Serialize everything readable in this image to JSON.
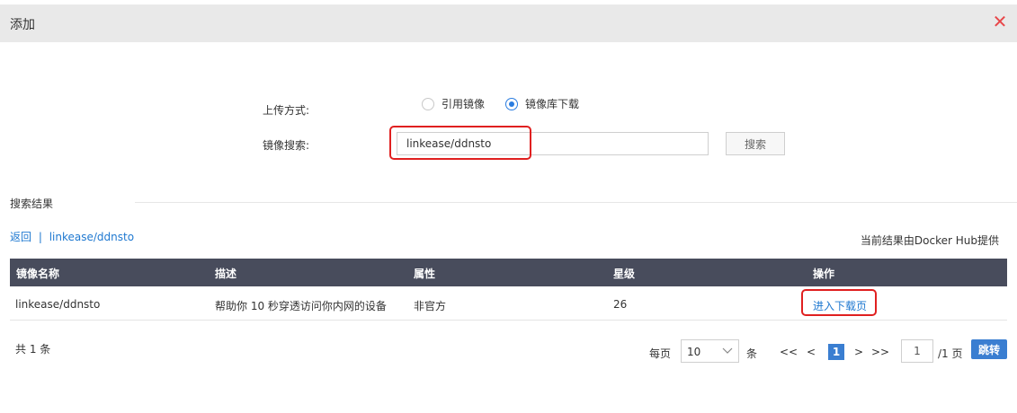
{
  "dialog": {
    "title": "添加",
    "close_icon": "close-icon",
    "close_color": "#e8474a"
  },
  "form": {
    "upload_label": "上传方式:",
    "options": [
      "引用镜像",
      "镜像库下载"
    ],
    "selected_option": "镜像库下载",
    "search_label": "镜像搜索:",
    "search_value": "linkease/ddnsto",
    "search_button": "搜索"
  },
  "results": {
    "section_title": "搜索结果",
    "back_link": "返回",
    "separator": "|",
    "query": "linkease/ddnsto",
    "provider_note": "当前结果由Docker Hub提供"
  },
  "table": {
    "columns": [
      "镜像名称",
      "描述",
      "属性",
      "星级",
      "操作"
    ],
    "rows": [
      {
        "name": "linkease/ddnsto",
        "desc": "帮助你 10 秒穿透访问你内网的设备",
        "attr": "非官方",
        "stars": "26",
        "action": "进入下载页"
      }
    ]
  },
  "pagination": {
    "total": "共 1 条",
    "per_page_label": "每页",
    "per_page_value": "10",
    "per_page_unit": "条",
    "first": "<<",
    "prev": "<",
    "current_page": "1",
    "next": ">",
    "last": ">>",
    "page_input": "1",
    "page_total": "/1 页",
    "jump_button": "跳转"
  },
  "colors": {
    "accent": "#3a7ed1",
    "link": "#1e78d0",
    "header_bg": "#484c5c",
    "highlight": "#e02020"
  }
}
